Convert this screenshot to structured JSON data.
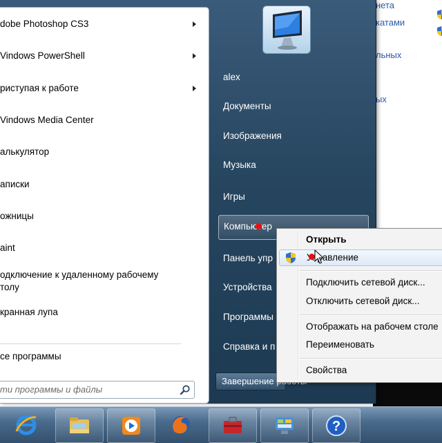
{
  "background_window": {
    "links": [
      "нета",
      "катами",
      "льных",
      "ых"
    ]
  },
  "left_pane": {
    "programs": [
      {
        "label": "dobe Photoshop CS3",
        "has_submenu": true
      },
      {
        "label": "Vindows PowerShell",
        "has_submenu": true
      },
      {
        "label": "риступая к работе",
        "has_submenu": true
      },
      {
        "label": "Vindows Media Center",
        "has_submenu": false
      },
      {
        "label": "алькулятор",
        "has_submenu": false
      },
      {
        "label": "аписки",
        "has_submenu": false
      },
      {
        "label": "ожницы",
        "has_submenu": false
      },
      {
        "label": "aint",
        "has_submenu": false
      },
      {
        "label": "одключение к удаленному рабочему\nтолу",
        "has_submenu": false
      },
      {
        "label": "кранная лупа",
        "has_submenu": false
      }
    ],
    "all_programs": "се программы",
    "search_placeholder": "ти программы и файлы"
  },
  "right_pane": {
    "items": [
      {
        "label": "alex"
      },
      {
        "label": "Документы"
      },
      {
        "label": "Изображения"
      },
      {
        "label": "Музыка"
      },
      {
        "label": "Игры"
      },
      {
        "label": "Компьютер"
      },
      {
        "label": "Панель упр"
      },
      {
        "label": "Устройства"
      },
      {
        "label": "Программы"
      },
      {
        "label": "Справка и п"
      }
    ],
    "hover_index": 5,
    "shutdown_label": "Завершение работы"
  },
  "context_menu": {
    "groups": [
      [
        {
          "label": "Открыть",
          "bold": true
        },
        {
          "label": "Управление",
          "shield": true
        }
      ],
      [
        {
          "label": "Подключить сетевой диск..."
        },
        {
          "label": "Отключить сетевой диск..."
        }
      ],
      [
        {
          "label": "Отображать на рабочем столе"
        },
        {
          "label": "Переименовать"
        }
      ],
      [
        {
          "label": "Свойства"
        }
      ]
    ],
    "hover_index": 1
  },
  "taskbar": {
    "icons": [
      "internet-explorer-icon",
      "windows-explorer-icon",
      "media-player-icon",
      "firefox-icon",
      "toolbox-icon",
      "control-panel-icon",
      "help-icon"
    ]
  },
  "colors": {
    "start_frame": "#26455f",
    "taskbar": "#4a6b8d",
    "context_hover": "#dde9f7",
    "pointer_dot": "#e81010"
  }
}
